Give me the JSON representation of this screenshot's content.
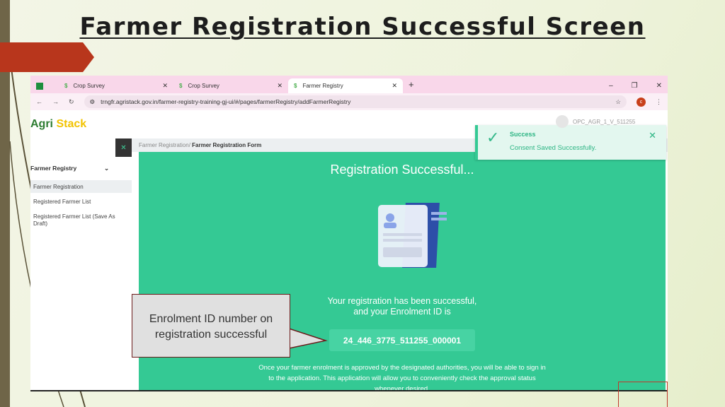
{
  "slide": {
    "title": "Farmer Registration Successful Screen",
    "callout": "Enrolment ID number on registration successful"
  },
  "browser": {
    "tabs": [
      {
        "label": "Crop Survey"
      },
      {
        "label": "Crop Survey"
      },
      {
        "label": "Farmer Registry",
        "active": true
      }
    ],
    "url": "trngfr.agristack.gov.in/farmer-registry-training-gj-ui/#/pages/farmerRegistry/addFarmerRegistry",
    "profile_initial": "c"
  },
  "app": {
    "logo_prefix": "Agri",
    "logo_suffix": "Stack",
    "user": "OPC_AGR_1_V_511255",
    "sidebar": {
      "heading": "Farmer Registry",
      "items": [
        "Farmer Registration",
        "Registered Farmer List",
        "Registered Farmer List (Save As Draft)"
      ]
    },
    "breadcrumb": {
      "parent": "Farmer Registration/",
      "current": "Farmer Registration Form"
    },
    "main": {
      "title": "Registration Successful...",
      "message_line1": "Your registration has been successful,",
      "message_line2": "and your Enrolment ID is",
      "enrolment_id": "24_446_3775_511255_000001",
      "note": "Once your farmer enrolment is approved by the designated authorities, you will be able to sign in to the application. This application will allow you to conveniently check the approval status whenever desired."
    },
    "toast": {
      "title": "Success",
      "message": "Consent Saved Successfully."
    }
  },
  "colors": {
    "accent": "#34c994",
    "arrow": "#b8361c"
  }
}
